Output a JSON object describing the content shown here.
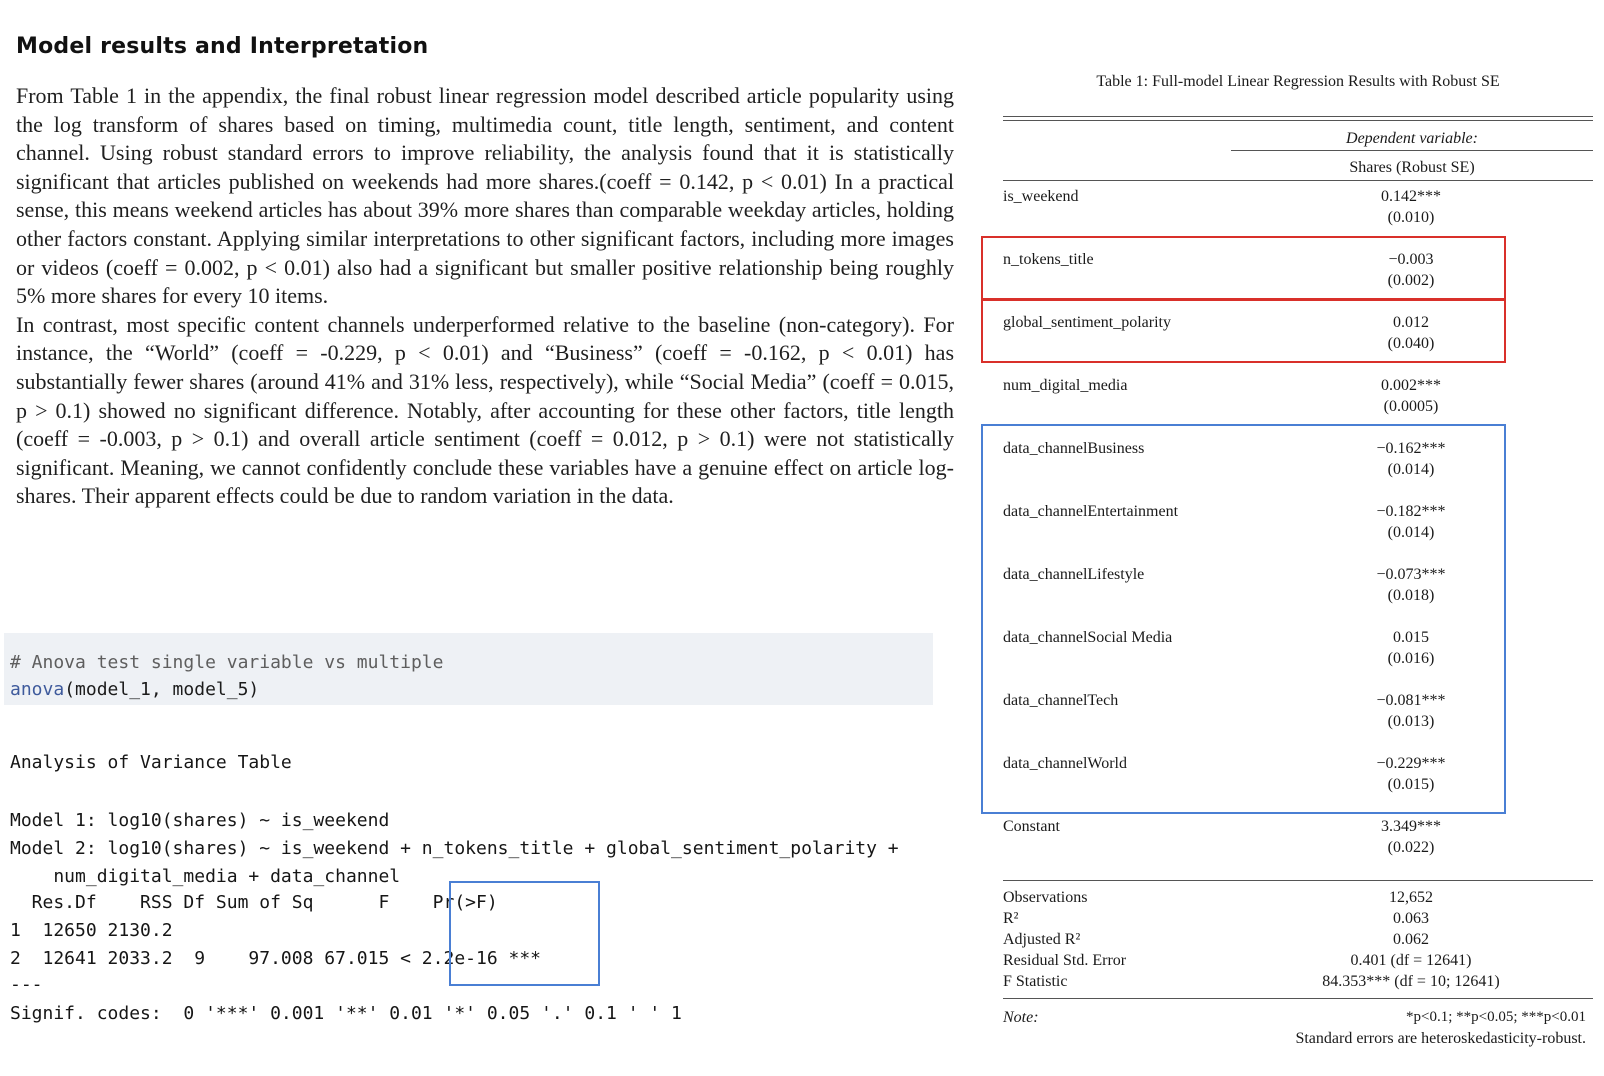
{
  "heading": "Model results and Interpretation",
  "paragraph1": "From Table 1 in the appendix, the final robust linear regression model described article popularity using the log transform of shares based on timing, multimedia count, title length, sentiment, and content channel. Using robust standard errors to improve reliability, the analysis found that it is statistically significant that articles published on weekends had more shares.(coeff = 0.142, p < 0.01) In a practical sense, this means weekend articles has about 39% more shares than comparable weekday articles, holding other factors constant. Applying similar interpretations to other significant factors, including more images or videos (coeff = 0.002, p < 0.01) also had a significant but smaller positive relationship being roughly 5% more shares for every 10 items.",
  "paragraph2": "In contrast, most specific content channels underperformed relative to the baseline (non-category). For instance, the “World” (coeff = -0.229, p < 0.01) and “Business” (coeff = -0.162, p < 0.01) has substantially fewer shares (around 41% and 31% less, respectively), while “Social Media” (coeff = 0.015, p > 0.1) showed no significant difference. Notably, after accounting for these other factors, title length (coeff = -0.003, p > 0.1) and overall article sentiment (coeff = 0.012, p > 0.1) were not statistically significant. Meaning, we cannot confidently conclude these variables have a genuine effect on article log-shares. Their apparent effects could be due to random variation in the data.",
  "code": {
    "comment": "# Anova test single variable vs multiple",
    "fn": "anova",
    "args": "(model_1, model_5)"
  },
  "anova_output": {
    "title": "Analysis of Variance Table",
    "model1": "Model 1: log10(shares) ~ is_weekend",
    "model2a": "Model 2: log10(shares) ~ is_weekend + n_tokens_title + global_sentiment_polarity +",
    "model2b": "    num_digital_media + data_channel",
    "header": "  Res.Df    RSS Df Sum of Sq      F    Pr(>F)",
    "row1": "1  12650 2130.2",
    "row2": "2  12641 2033.2  9    97.008 67.015 < 2.2e-16 ***",
    "sep": "---",
    "signif": "Signif. codes:  0 '***' 0.001 '**' 0.01 '*' 0.05 '.' 0.1 ' ' 1"
  },
  "table": {
    "caption": "Table 1: Full-model Linear Regression Results with Robust SE",
    "dep_var_label": "Dependent variable:",
    "dep_var_name": "Shares (Robust SE)",
    "rows": [
      {
        "var": "is_weekend",
        "coef": "0.142***",
        "se": "(0.010)"
      },
      {
        "var": "n_tokens_title",
        "coef": "−0.003",
        "se": "(0.002)"
      },
      {
        "var": "global_sentiment_polarity",
        "coef": "0.012",
        "se": "(0.040)"
      },
      {
        "var": "num_digital_media",
        "coef": "0.002***",
        "se": "(0.0005)"
      },
      {
        "var": "data_channelBusiness",
        "coef": "−0.162***",
        "se": "(0.014)"
      },
      {
        "var": "data_channelEntertainment",
        "coef": "−0.182***",
        "se": "(0.014)"
      },
      {
        "var": "data_channelLifestyle",
        "coef": "−0.073***",
        "se": "(0.018)"
      },
      {
        "var": "data_channelSocial Media",
        "coef": "0.015",
        "se": "(0.016)"
      },
      {
        "var": "data_channelTech",
        "coef": "−0.081***",
        "se": "(0.013)"
      },
      {
        "var": "data_channelWorld",
        "coef": "−0.229***",
        "se": "(0.015)"
      },
      {
        "var": "Constant",
        "coef": "3.349***",
        "se": "(0.022)"
      }
    ],
    "stats": [
      {
        "label": "Observations",
        "value": "12,652"
      },
      {
        "label": "R²",
        "value": "0.063"
      },
      {
        "label": "Adjusted R²",
        "value": "0.062"
      },
      {
        "label": "Residual Std. Error",
        "value": "0.401 (df = 12641)"
      },
      {
        "label": "F Statistic",
        "value": "84.353*** (df = 10; 12641)"
      }
    ],
    "note_label": "Note:",
    "note_line1": "*p<0.1; **p<0.05; ***p<0.01",
    "note_line2": "Standard errors are heteroskedasticity-robust."
  },
  "colors": {
    "highlight_red": "#d9302a",
    "highlight_blue": "#4a7fd4",
    "code_bg": "#eef1f5"
  }
}
